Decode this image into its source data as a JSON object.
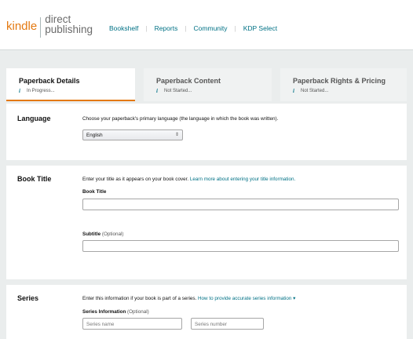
{
  "header": {
    "logo": {
      "kindle": "kindle",
      "line1": "direct",
      "line2": "publishing"
    },
    "nav": [
      "Bookshelf",
      "Reports",
      "Community",
      "KDP Select"
    ],
    "nav_sep": "|"
  },
  "tabs": [
    {
      "title": "Paperback Details",
      "status": "In Progress..."
    },
    {
      "title": "Paperback Content",
      "status": "Not Started..."
    },
    {
      "title": "Paperback Rights & Pricing",
      "status": "Not Started..."
    }
  ],
  "language": {
    "label": "Language",
    "description": "Choose your paperback's primary language (the language in which the book was written).",
    "selected": "English"
  },
  "book_title": {
    "label": "Book Title",
    "description": "Enter your title as it appears on your book cover.",
    "link": "Learn more about entering your title information.",
    "title_label": "Book Title",
    "subtitle_label": "Subtitle",
    "subtitle_optional": "(Optional)"
  },
  "series": {
    "label": "Series",
    "description": "Enter this information if your book is part of a series.",
    "link": "How to provide accurate series information",
    "link_caret": "▾",
    "info_label": "Series Information",
    "info_optional": "(Optional)",
    "name_placeholder": "Series name",
    "number_placeholder": "Series number"
  },
  "colors": {
    "accent": "#e47911",
    "link": "#007185",
    "page_bg": "#eaeded"
  }
}
